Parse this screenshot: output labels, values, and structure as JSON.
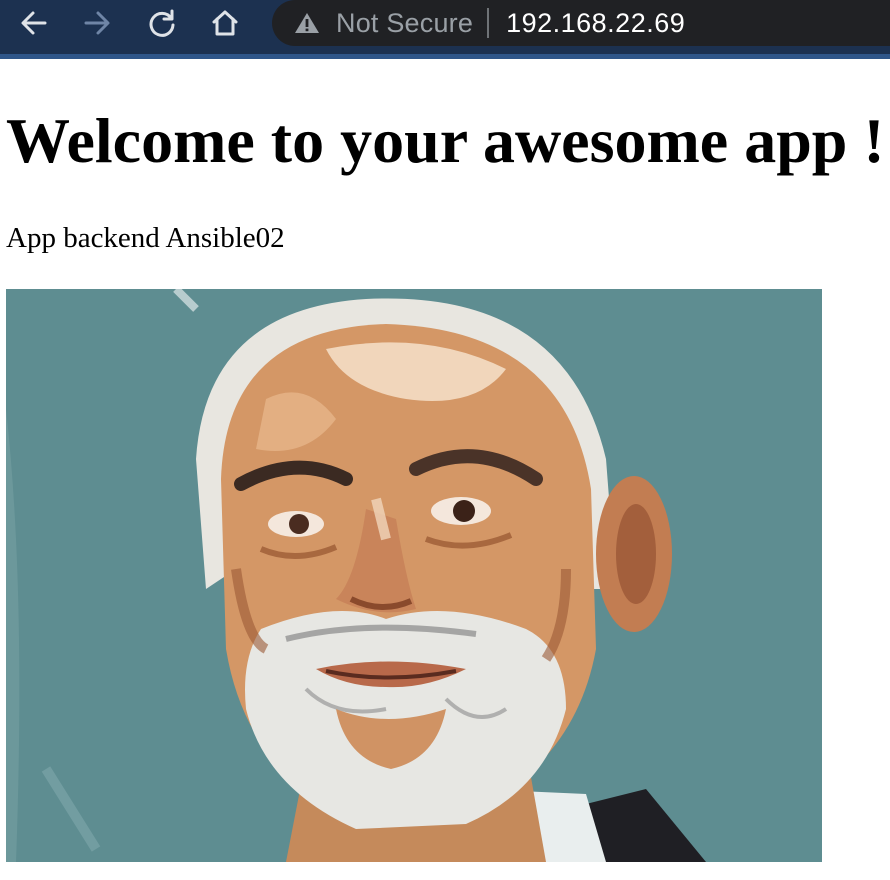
{
  "browser": {
    "security_label": "Not Secure",
    "url": "192.168.22.69",
    "icons": [
      "back-arrow-icon",
      "forward-arrow-icon",
      "reload-icon",
      "home-icon",
      "warning-icon"
    ]
  },
  "page": {
    "title": "Welcome to your awesome app !",
    "subtitle": "App backend Ansible02"
  },
  "colors": {
    "toolbar_bg": "#1c3150",
    "omnibox_bg": "#202124",
    "portrait_bg": "#5e8d91"
  }
}
